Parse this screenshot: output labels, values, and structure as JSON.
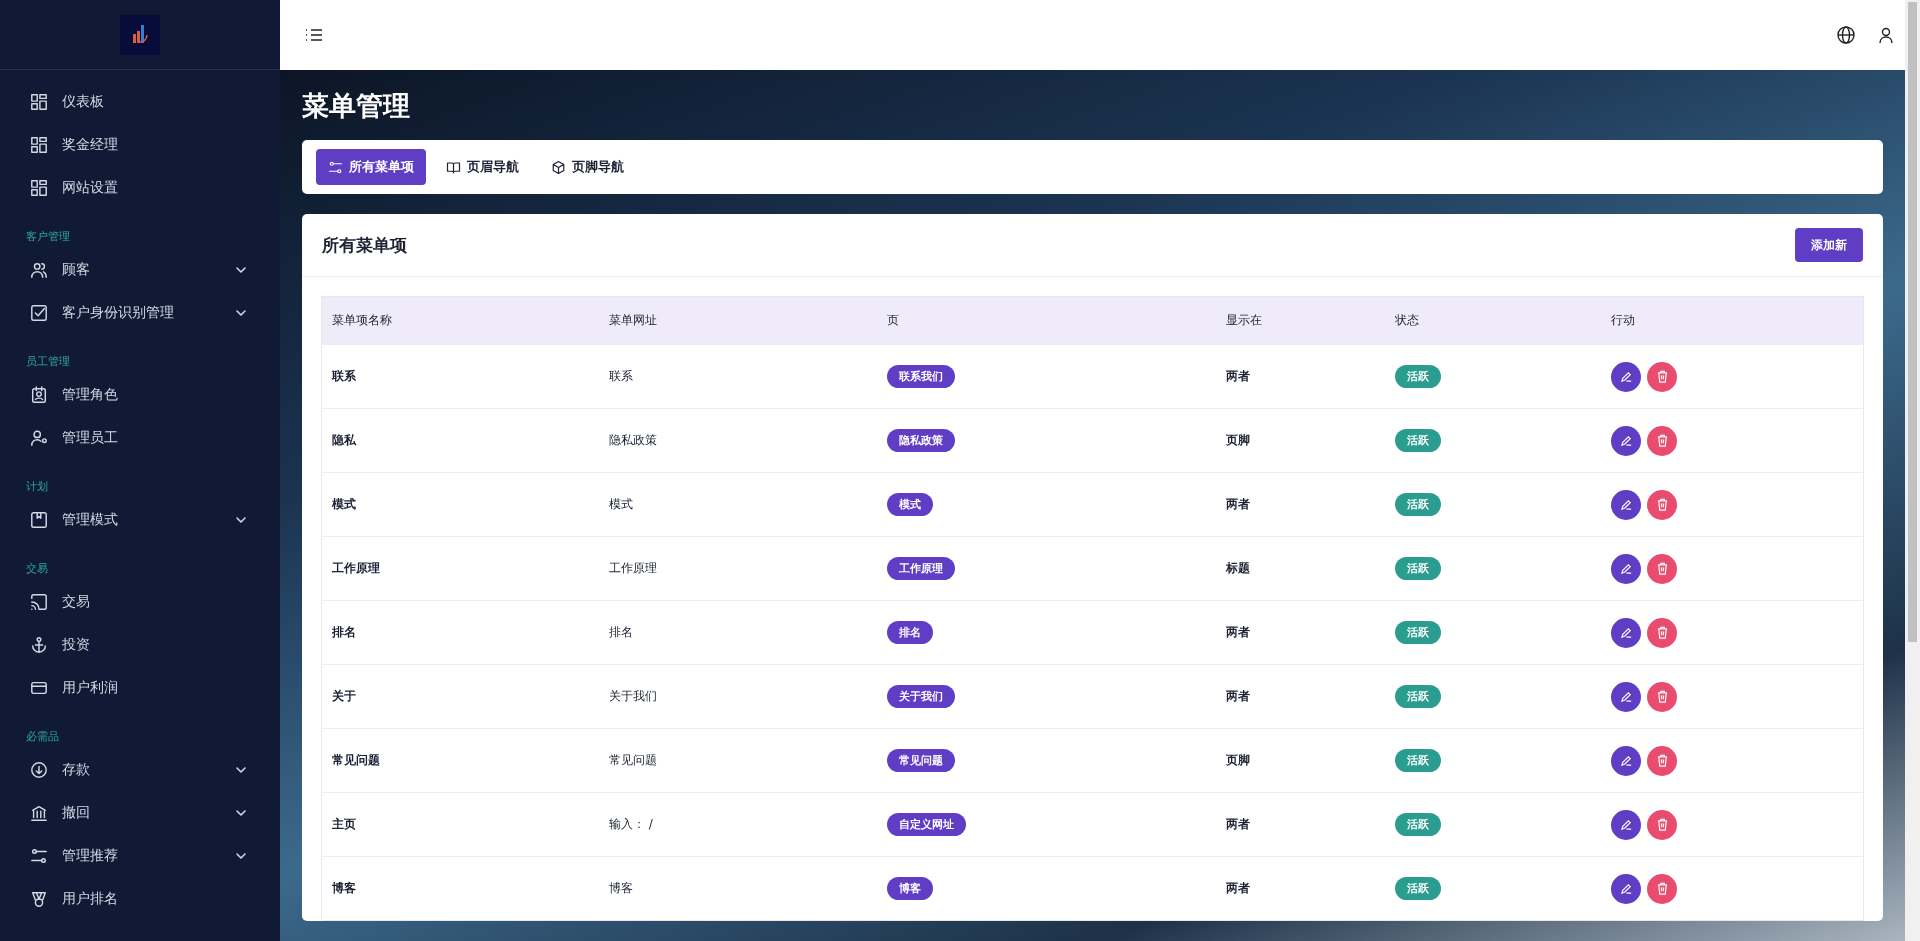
{
  "sidebar": {
    "sections": [
      {
        "items": [
          {
            "label": "仪表板",
            "expandable": false
          },
          {
            "label": "奖金经理",
            "expandable": false
          },
          {
            "label": "网站设置",
            "expandable": false
          }
        ]
      },
      {
        "title": "客户管理",
        "items": [
          {
            "label": "顾客",
            "expandable": true
          },
          {
            "label": "客户身份识别管理",
            "expandable": true
          }
        ]
      },
      {
        "title": "员工管理",
        "items": [
          {
            "label": "管理角色",
            "expandable": false
          },
          {
            "label": "管理员工",
            "expandable": false
          }
        ]
      },
      {
        "title": "计划",
        "items": [
          {
            "label": "管理模式",
            "expandable": true
          }
        ]
      },
      {
        "title": "交易",
        "items": [
          {
            "label": "交易",
            "expandable": false
          },
          {
            "label": "投资",
            "expandable": false
          },
          {
            "label": "用户利润",
            "expandable": false
          }
        ]
      },
      {
        "title": "必需品",
        "items": [
          {
            "label": "存款",
            "expandable": true
          },
          {
            "label": "撤回",
            "expandable": true
          },
          {
            "label": "管理推荐",
            "expandable": true
          },
          {
            "label": "用户排名",
            "expandable": false
          }
        ]
      }
    ]
  },
  "page_title": "菜单管理",
  "tabs": [
    {
      "label": "所有菜单项",
      "selected": true
    },
    {
      "label": "页眉导航",
      "selected": false
    },
    {
      "label": "页脚导航",
      "selected": false
    }
  ],
  "card": {
    "title": "所有菜单项",
    "add_button": "添加新",
    "table": {
      "columns": [
        "菜单项名称",
        "菜单网址",
        "页",
        "显示在",
        "状态",
        "行动"
      ],
      "rows": [
        {
          "name": "联系",
          "url": "联系",
          "page": "联系我们",
          "show_in": "两者",
          "status": "活跃"
        },
        {
          "name": "隐私",
          "url": "隐私政策",
          "page": "隐私政策",
          "show_in": "页脚",
          "status": "活跃"
        },
        {
          "name": "模式",
          "url": "模式",
          "page": "模式",
          "show_in": "两者",
          "status": "活跃"
        },
        {
          "name": "工作原理",
          "url": "工作原理",
          "page": "工作原理",
          "show_in": "标题",
          "status": "活跃"
        },
        {
          "name": "排名",
          "url": "排名",
          "page": "排名",
          "show_in": "两者",
          "status": "活跃"
        },
        {
          "name": "关于",
          "url": "关于我们",
          "page": "关于我们",
          "show_in": "两者",
          "status": "活跃"
        },
        {
          "name": "常见问题",
          "url": "常见问题",
          "page": "常见问题",
          "show_in": "页脚",
          "status": "活跃"
        },
        {
          "name": "主页",
          "url": "输入： /",
          "page": "自定义网址",
          "show_in": "两者",
          "status": "活跃"
        },
        {
          "name": "博客",
          "url": "博客",
          "page": "博客",
          "show_in": "两者",
          "status": "活跃"
        }
      ]
    }
  }
}
